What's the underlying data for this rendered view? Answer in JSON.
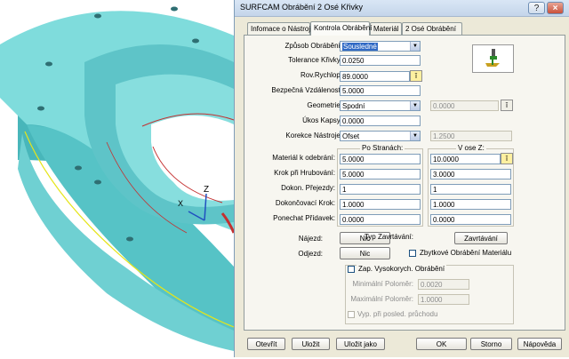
{
  "window": {
    "title": "SURFCAM Obrábění 2 Osé Křivky",
    "help_label": "?",
    "close_label": "×"
  },
  "tabs": [
    {
      "label": "Infomace o Nástroji"
    },
    {
      "label": "Kontrola Obrábění"
    },
    {
      "label": "Materiál"
    },
    {
      "label": "2 Osé Obrábění"
    }
  ],
  "form": {
    "zpusob": {
      "label": "Způsob Obrábění:",
      "value": "Sousledné"
    },
    "tolerance": {
      "label": "Tolerance Křivky:",
      "value": "0.0250"
    },
    "rovina": {
      "label": "Rov.Rychlop:",
      "value": "89.0000"
    },
    "bezpecna": {
      "label": "Bezpečná Vzdálenost:",
      "value": "5.0000"
    },
    "geometrie": {
      "label": "Geometrie:",
      "value": "Spodní",
      "aux_value": "0.0000"
    },
    "ukos": {
      "label": "Úkos Kapsy:",
      "value": "0.0000"
    },
    "korekce": {
      "label": "Korekce Nástroje:",
      "value": "Ofset",
      "aux_value": "1.2500"
    }
  },
  "grid": {
    "col_header_left": "Po Stranách:",
    "col_header_right": "V ose Z:",
    "rows": [
      {
        "label": "Materiál k odebrání:",
        "left": "5.0000",
        "right": "10.0000"
      },
      {
        "label": "Krok při Hrubování:",
        "left": "5.0000",
        "right": "3.0000"
      },
      {
        "label": "Dokon. Přejezdy:",
        "left": "1",
        "right": "1"
      },
      {
        "label": "Dokončovací Krok:",
        "left": "1.0000",
        "right": "1.0000"
      },
      {
        "label": "Ponechat Přídavek:",
        "left": "0.0000",
        "right": "0.0000"
      }
    ]
  },
  "najezd": {
    "label": "Nájezd:",
    "button": "Nic"
  },
  "odjezd": {
    "label": "Odjezd:",
    "button": "Nic"
  },
  "typ_zavtaveni": {
    "label": "Typ Zavrtávání:",
    "button": "Zavrtávání"
  },
  "zbytkove": {
    "label": "Zbytkové Obrábění Materiálu",
    "checked": false
  },
  "vysokorychlostni": {
    "label": "Zap. Vysokorych. Obrábění",
    "min_label": "Minimální Poloměr:",
    "min_value": "0.0020",
    "max_label": "Maximální Poloměr:",
    "max_value": "1.0000",
    "vyp_label": "Vyp. při posled. průchodu"
  },
  "buttons": {
    "otevrit": "Otevřít",
    "ulozit": "Uložit",
    "ulozit_jako": "Uložit jako",
    "ok": "OK",
    "storno": "Storno",
    "napoveda": "Nápověda"
  },
  "cad": {
    "axis_z_label": "Z",
    "axis_x_label": "X"
  },
  "colors": {
    "part_fill": "#7dd8d8",
    "part_shadow": "#3fa9ae",
    "edge_yellow": "#e5e51a",
    "edge_red": "#c43030"
  }
}
